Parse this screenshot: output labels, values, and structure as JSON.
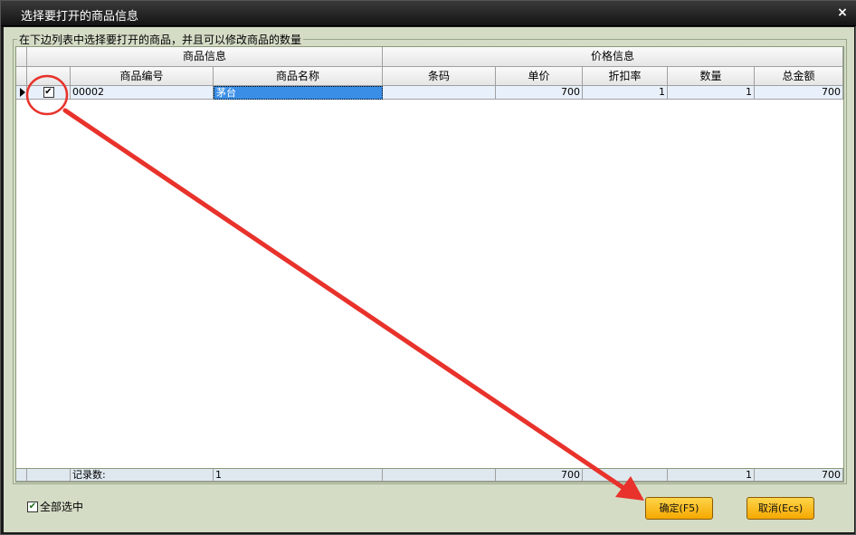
{
  "window": {
    "title": "选择要打开的商品信息",
    "close_label": "×"
  },
  "group": {
    "legend": "在下边列表中选择要打开的商品，并且可以修改商品的数量"
  },
  "table": {
    "group_headers": {
      "product_info": "商品信息",
      "price_info": "价格信息"
    },
    "columns": [
      "商品编号",
      "商品名称",
      "条码",
      "单价",
      "折扣率",
      "数量",
      "总金额"
    ],
    "rows": [
      {
        "checked": "✔",
        "code": "00002",
        "name": "茅台",
        "barcode": "",
        "price": "700",
        "discount": "1",
        "qty": "1",
        "total": "700"
      }
    ],
    "footer": {
      "label": "记录数:",
      "count": "1",
      "price": "700",
      "qty": "1",
      "total": "700"
    }
  },
  "select_all": {
    "checked": "✔",
    "label": "全部选中"
  },
  "buttons": {
    "ok": "确定(F5)",
    "cancel": "取消(Ecs)"
  },
  "annotation": {
    "color": "#e8322b"
  }
}
